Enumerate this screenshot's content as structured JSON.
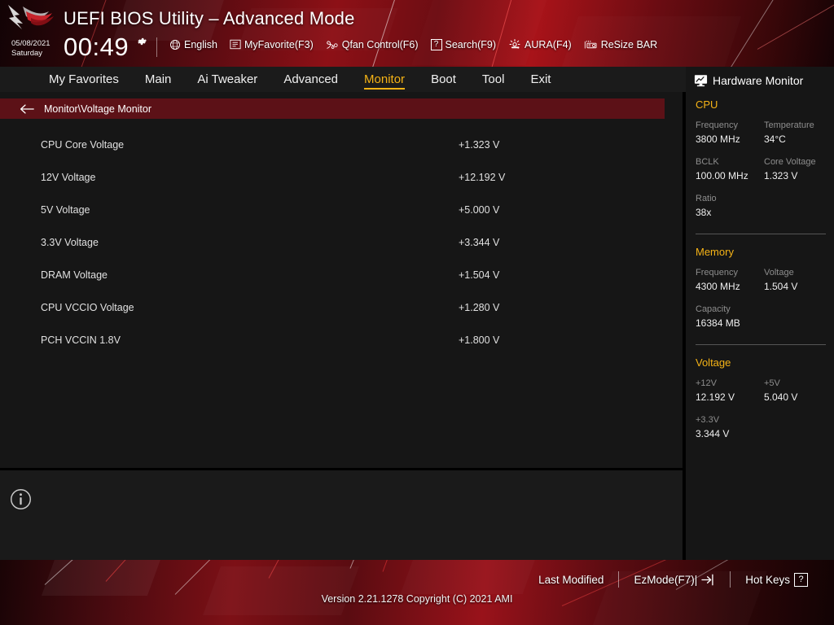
{
  "header": {
    "title": "UEFI BIOS Utility – Advanced Mode",
    "date": "05/08/2021",
    "weekday": "Saturday",
    "time": "00:49",
    "clock_settings_icon": "gear-icon",
    "logo_icon": "rog-logo-icon",
    "tools": [
      {
        "label": "English",
        "icon": "globe-icon"
      },
      {
        "label": "MyFavorite(F3)",
        "icon": "list-icon"
      },
      {
        "label": "Qfan Control(F6)",
        "icon": "fan-icon"
      },
      {
        "label": "Search(F9)",
        "icon": "question-box-icon"
      },
      {
        "label": "AURA(F4)",
        "icon": "aura-light-icon"
      },
      {
        "label": "ReSize BAR",
        "icon": "gpu-card-icon"
      }
    ]
  },
  "nav": {
    "tabs": [
      {
        "label": "My Favorites",
        "active": false
      },
      {
        "label": "Main",
        "active": false
      },
      {
        "label": "Ai Tweaker",
        "active": false
      },
      {
        "label": "Advanced",
        "active": false
      },
      {
        "label": "Monitor",
        "active": true
      },
      {
        "label": "Boot",
        "active": false
      },
      {
        "label": "Tool",
        "active": false
      },
      {
        "label": "Exit",
        "active": false
      }
    ],
    "active_color": "#f5b316"
  },
  "breadcrumb": {
    "back_icon": "arrow-left-icon",
    "path": "Monitor\\Voltage Monitor"
  },
  "voltages": [
    {
      "label": "CPU Core Voltage",
      "value": "+1.323 V"
    },
    {
      "label": "12V Voltage",
      "value": "+12.192 V"
    },
    {
      "label": "5V Voltage",
      "value": "+5.000 V"
    },
    {
      "label": "3.3V Voltage",
      "value": "+3.344 V"
    },
    {
      "label": "DRAM Voltage",
      "value": "+1.504 V"
    },
    {
      "label": "CPU VCCIO Voltage",
      "value": "+1.280 V"
    },
    {
      "label": "PCH VCCIN 1.8V",
      "value": "+1.800 V"
    }
  ],
  "help_panel": {
    "info_icon": "info-circle-icon",
    "text": ""
  },
  "hardware_monitor": {
    "title": "Hardware Monitor",
    "icon": "monitor-chart-icon",
    "sections": [
      {
        "name": "CPU",
        "entries": [
          {
            "key": "Frequency",
            "value": "3800 MHz"
          },
          {
            "key": "Temperature",
            "value": "34°C"
          },
          {
            "key": "BCLK",
            "value": "100.00 MHz"
          },
          {
            "key": "Core Voltage",
            "value": "1.323 V"
          },
          {
            "key": "Ratio",
            "value": "38x"
          }
        ]
      },
      {
        "name": "Memory",
        "entries": [
          {
            "key": "Frequency",
            "value": "4300 MHz"
          },
          {
            "key": "Voltage",
            "value": "1.504 V"
          },
          {
            "key": "Capacity",
            "value": "16384 MB"
          }
        ]
      },
      {
        "name": "Voltage",
        "entries": [
          {
            "key": "+12V",
            "value": "12.192 V"
          },
          {
            "key": "+5V",
            "value": "5.040 V"
          },
          {
            "key": "+3.3V",
            "value": "3.344 V"
          }
        ]
      }
    ],
    "section_color": "#f5b316"
  },
  "footer": {
    "controls": [
      {
        "label": "Last Modified",
        "icon": ""
      },
      {
        "label": "EzMode(F7)|",
        "icon": "exit-arrow-icon"
      },
      {
        "label": "Hot Keys",
        "icon": "question-box-icon"
      }
    ],
    "version": "Version 2.21.1278 Copyright (C) 2021 AMI"
  }
}
